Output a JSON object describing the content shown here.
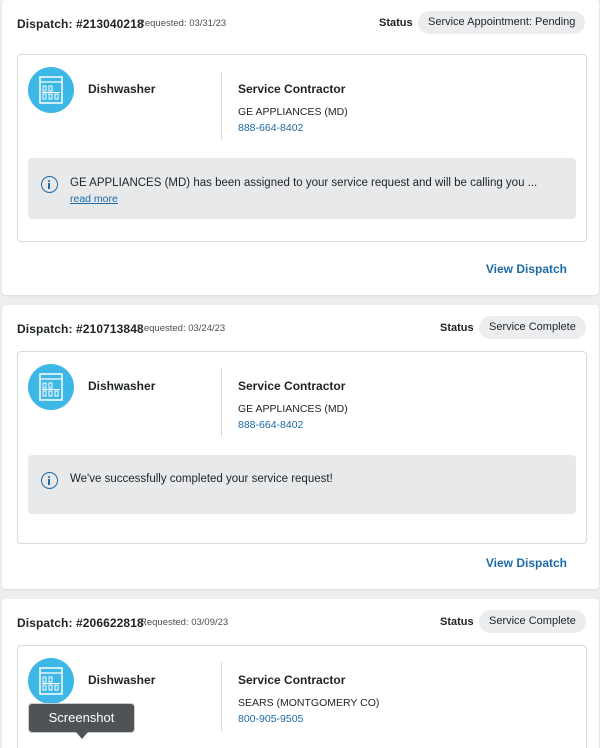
{
  "dispatches": [
    {
      "dispatch_number": "Dispatch: #213040218",
      "requested": "Requested: 03/31/23",
      "status_label": "Status",
      "status": "Service Appointment: Pending",
      "appliance": "Dishwasher",
      "contractor_title": "Service Contractor",
      "contractor_name": "GE APPLIANCES (MD)",
      "contractor_phone": "888-664-8402",
      "notice": "GE APPLIANCES (MD) has been assigned to your service request and will be calling you ...",
      "read_more": "read more",
      "view_dispatch": "View Dispatch"
    },
    {
      "dispatch_number": "Dispatch: #210713848",
      "requested": "Requested: 03/24/23",
      "status_label": "Status",
      "status": "Service Complete",
      "appliance": "Dishwasher",
      "contractor_title": "Service Contractor",
      "contractor_name": "GE APPLIANCES (MD)",
      "contractor_phone": "888-664-8402",
      "notice": "We've successfully completed your service request!",
      "view_dispatch": "View Dispatch"
    },
    {
      "dispatch_number": "Dispatch: #206622818",
      "requested": "Requested: 03/09/23",
      "status_label": "Status",
      "status": "Service Complete",
      "appliance": "Dishwasher",
      "contractor_title": "Service Contractor",
      "contractor_name": "SEARS (MONTGOMERY CO)",
      "contractor_phone": "800-905-9505"
    }
  ],
  "tooltip": "Screenshot",
  "icons": {
    "appliance": "dishwasher-icon",
    "notice": "info-icon"
  },
  "colors": {
    "accent": "#1d6aa5",
    "icon_bg": "#3cb7e6",
    "pill_bg": "#ecedef",
    "notice_bg": "#e8e9eb"
  }
}
